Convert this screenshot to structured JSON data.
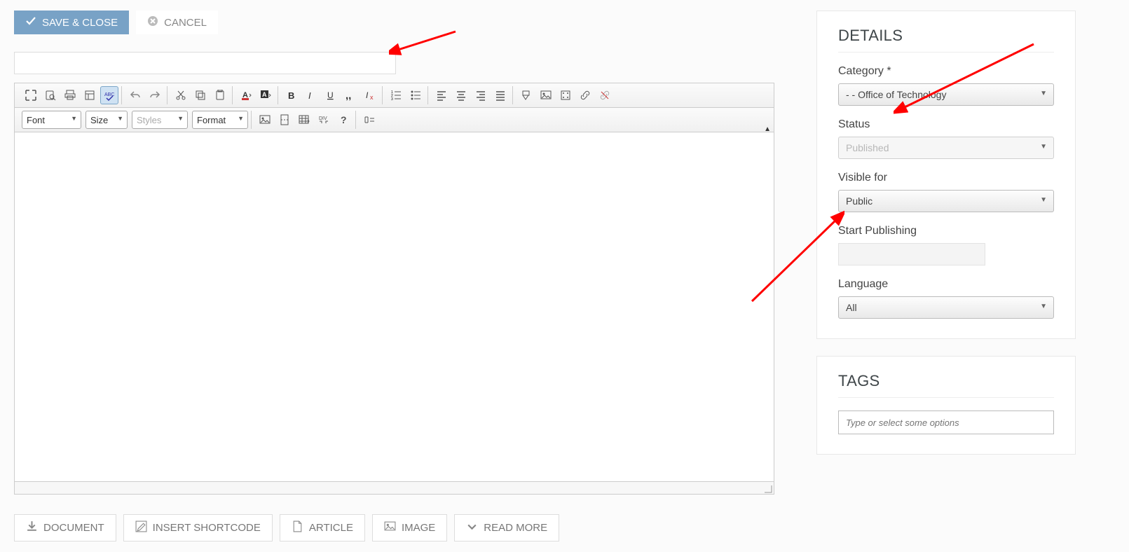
{
  "buttons": {
    "save_close": "SAVE & CLOSE",
    "cancel": "CANCEL"
  },
  "title_input": {
    "value": "",
    "placeholder": ""
  },
  "toolbar": {
    "font_label": "Font",
    "size_label": "Size",
    "styles_placeholder": "Styles",
    "format_label": "Format"
  },
  "footer": {
    "document": "DOCUMENT",
    "insert_shortcode": "INSERT SHORTCODE",
    "article": "ARTICLE",
    "image": "IMAGE",
    "read_more": "READ MORE"
  },
  "details": {
    "heading": "DETAILS",
    "category_label": "Category *",
    "category_value": "- - Office of Technology",
    "status_label": "Status",
    "status_value": "Published",
    "visible_label": "Visible for",
    "visible_value": "Public",
    "start_pub_label": "Start Publishing",
    "start_pub_value": "",
    "language_label": "Language",
    "language_value": "All"
  },
  "tags": {
    "heading": "TAGS",
    "placeholder": "Type or select some options"
  }
}
